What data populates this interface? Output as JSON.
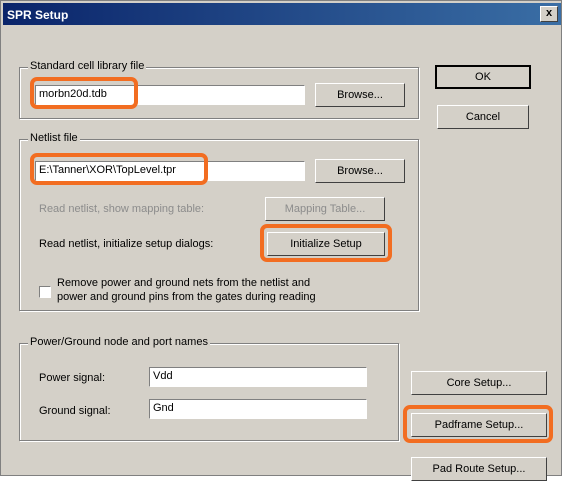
{
  "window": {
    "title": "SPR Setup",
    "close_glyph": "x"
  },
  "library": {
    "legend": "Standard cell library file",
    "value": "morbn20d.tdb",
    "browse_label": "Browse..."
  },
  "netlist": {
    "legend": "Netlist file",
    "value": "E:\\Tanner\\XOR\\TopLevel.tpr",
    "browse_label": "Browse...",
    "mapping_text": "Read netlist, show mapping table:",
    "mapping_button": "Mapping Table...",
    "initialize_text": "Read netlist, initialize setup dialogs:",
    "initialize_button": "Initialize Setup",
    "remove_text_line1": "Remove power and ground nets from the netlist and",
    "remove_text_line2": "power and ground pins from the gates during reading"
  },
  "power": {
    "legend": "Power/Ground node and port names",
    "power_label": "Power signal:",
    "power_value": "Vdd",
    "ground_label": "Ground signal:",
    "ground_value": "Gnd"
  },
  "buttons": {
    "ok": "OK",
    "cancel": "Cancel",
    "core_setup": "Core Setup...",
    "padframe_setup": "Padframe Setup...",
    "pad_route_setup": "Pad Route Setup..."
  },
  "colors": {
    "highlight": "#f26d21",
    "dialog_bg": "#d4d0c8",
    "title_bar": "#0a246a"
  }
}
